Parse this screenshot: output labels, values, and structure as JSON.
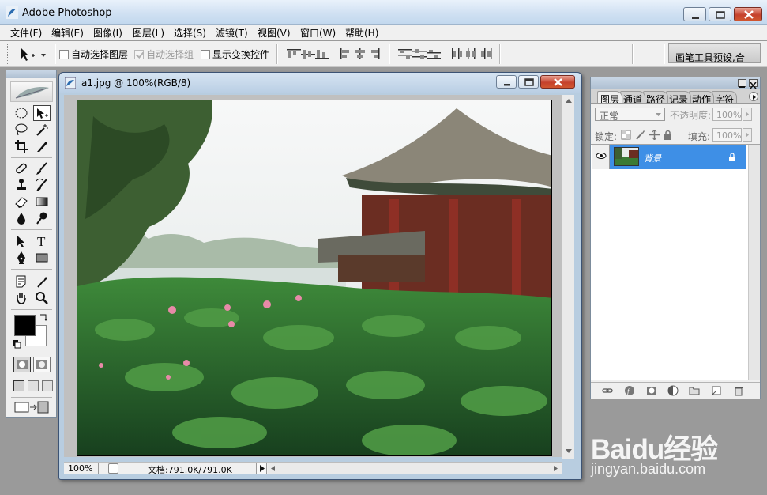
{
  "app": {
    "title": "Adobe Photoshop",
    "menu": [
      "文件(F)",
      "编辑(E)",
      "图像(I)",
      "图层(L)",
      "选择(S)",
      "滤镜(T)",
      "视图(V)",
      "窗口(W)",
      "帮助(H)"
    ]
  },
  "options_bar": {
    "auto_select_layer": "自动选择图层",
    "auto_select_group": "自动选择组",
    "show_transform": "显示变换控件",
    "palette_well_label": "画笔工具预设,合"
  },
  "document": {
    "title": "a1.jpg @ 100%(RGB/8)",
    "zoom": "100%",
    "doc_info": "文档:791.0K/791.0K"
  },
  "layers_palette": {
    "tabs": [
      "图层",
      "通道",
      "路径",
      "记录",
      "动作",
      "字符"
    ],
    "blend_mode": "正常",
    "opacity_label": "不透明度:",
    "opacity_value": "100%",
    "lock_label": "锁定:",
    "fill_label": "填充:",
    "fill_value": "100%",
    "layer_name": "背景"
  },
  "colors": {
    "foreground": "#000000",
    "background": "#ffffff",
    "layer_selected": "#3e8fe6"
  },
  "watermark": {
    "brand": "Baidu经验",
    "url": "jingyan.baidu.com"
  }
}
